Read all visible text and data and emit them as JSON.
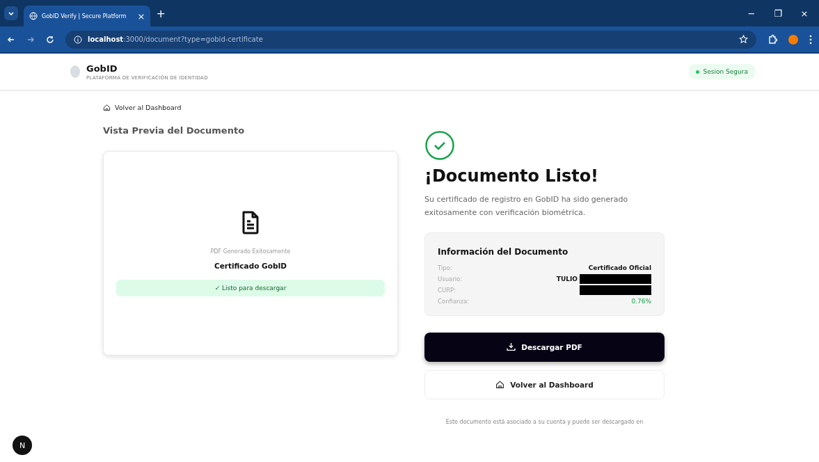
{
  "browser": {
    "tab_title": "GobID Verify | Secure Platform",
    "tab_close": "×",
    "new_tab": "+",
    "url_host": "localhost",
    "url_path": ":3000/document?type=gobid-certificate",
    "window_controls": [
      "−",
      "❐",
      "×"
    ]
  },
  "header": {
    "brand": "GobID",
    "subtitle": "PLATAFORMA DE VERIFICACIÓN DE IDENTIDAD",
    "badge": "Sesion Segura"
  },
  "back_link": "Volver al Dashboard",
  "preview": {
    "title": "Vista Previa del Documento",
    "caption": "PDF Generado Exitosamente",
    "name": "Certificado GobID",
    "status": "✓ Listo para descargar"
  },
  "result": {
    "title": "¡Documento Listo!",
    "message": "Su certificado de registro en GobID ha sido generado exitosamente con verificación biométrica."
  },
  "info": {
    "title": "Información del Documento",
    "rows": [
      {
        "label": "Tipo:",
        "value": "Certificado Oficial",
        "kind": "text",
        "redacted": false
      },
      {
        "label": "Usuario:",
        "value": "TULIO",
        "kind": "text",
        "redacted": true
      },
      {
        "label": "CURP:",
        "redacted": true
      },
      {
        "label": "Confianza:",
        "value": "0.76%",
        "kind": "positive",
        "redacted": false
      }
    ]
  },
  "buttons": [
    {
      "label": "Descargar PDF",
      "kind": "primary"
    },
    {
      "label": "Volver al Dashboard",
      "kind": "secondary"
    }
  ],
  "footnote": "Este documento está asociado a su cuenta y puede ser descargado en",
  "dev_badge": "N"
}
